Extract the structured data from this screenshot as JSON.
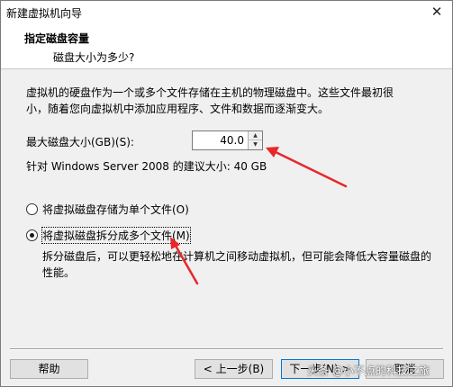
{
  "window": {
    "title": "新建虚拟机向导",
    "close_glyph": "✕"
  },
  "header": {
    "title": "指定磁盘容量",
    "subtitle": "磁盘大小为多少?"
  },
  "description": {
    "line1": "虚拟机的硬盘作为一个或多个文件存储在主机的物理磁盘中。这些文件最初很",
    "line2": "小，随着您向虚拟机中添加应用程序、文件和数据而逐渐变大。"
  },
  "disk_size": {
    "label": "最大磁盘大小(GB)(S):",
    "value": "40.0",
    "spin_up_glyph": "▲",
    "spin_down_glyph": "▼",
    "recommendation": "针对 Windows Server 2008 的建议大小: 40 GB"
  },
  "storage_options": [
    {
      "label": "将虚拟磁盘存储为单个文件(O)",
      "checked": false
    },
    {
      "label": "将虚拟磁盘拆分成多个文件(M)",
      "checked": true
    }
  ],
  "split_description": {
    "line1": "拆分磁盘后，可以更轻松地在计算机之间移动虚拟机，但可能会降低大容量磁盘的",
    "line2": "性能。"
  },
  "buttons": {
    "help": "帮助",
    "back": "< 上一步(B)",
    "next": "下一步(N) >",
    "cancel": "取消"
  },
  "watermark": "头条 @小不点的科技之旅",
  "colors": {
    "annotation_arrow": "#e8262b",
    "default_button_border": "#0078d7"
  },
  "icons": {
    "close": "close-icon",
    "spin_up": "spin-up-icon",
    "spin_down": "spin-down-icon"
  }
}
